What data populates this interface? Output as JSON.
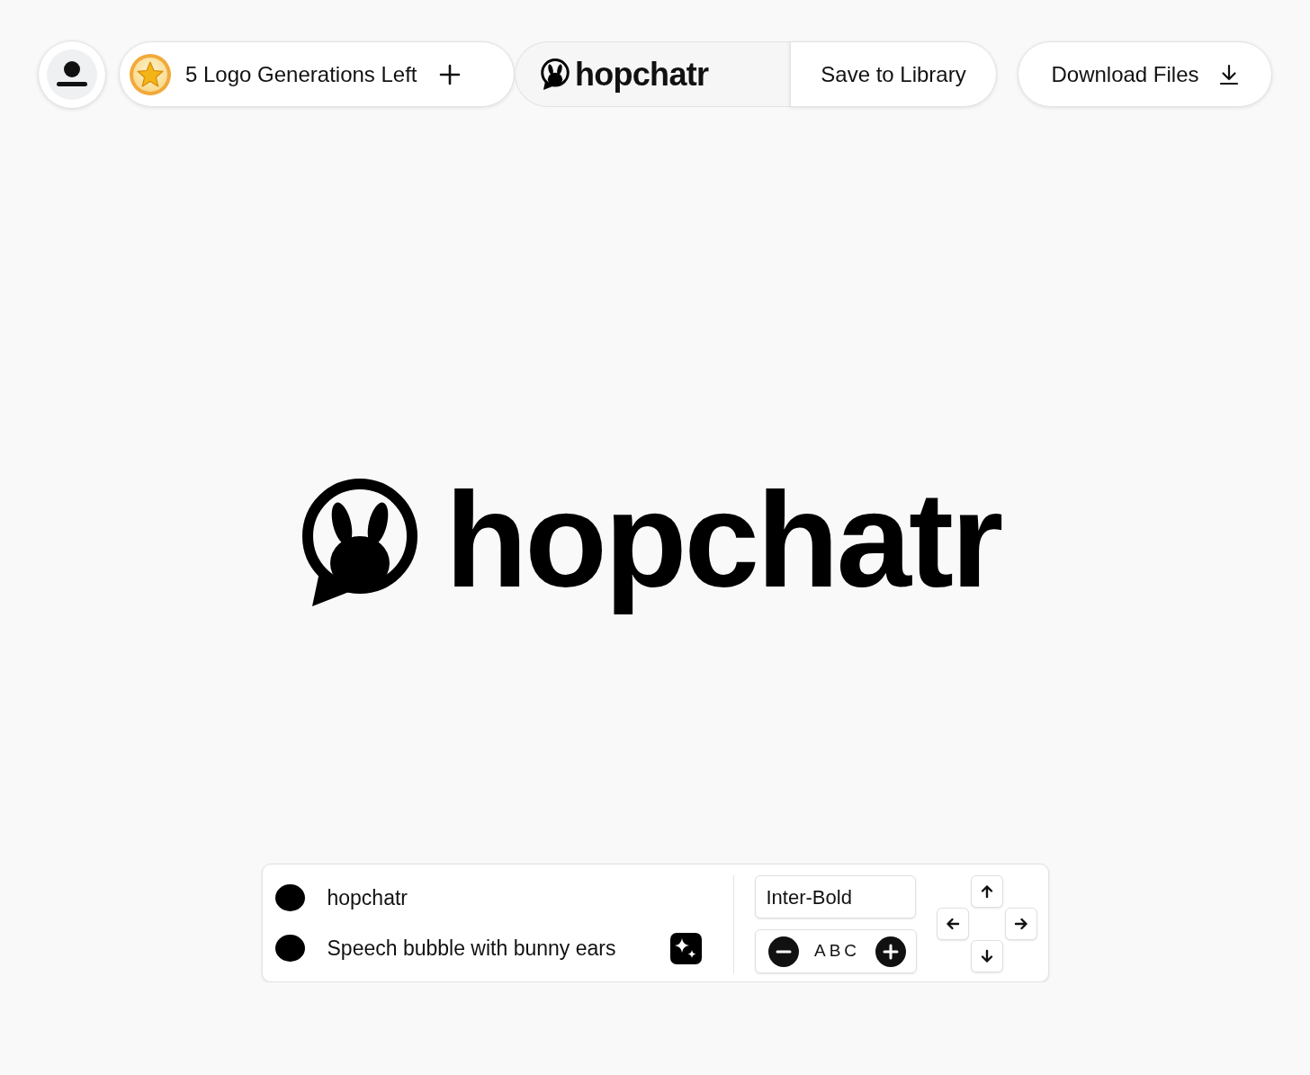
{
  "toolbar": {
    "credits_label": "5 Logo Generations Left",
    "logo_preview": "hopchatr",
    "save_button": "Save to Library",
    "download_button": "Download Files"
  },
  "canvas": {
    "wordmark": "hopchatr"
  },
  "editor": {
    "layers": [
      {
        "kind": "text",
        "color": "#000000",
        "value": "hopchatr"
      },
      {
        "kind": "icon",
        "color": "#000000",
        "value": "Speech bubble with bunny ears"
      }
    ],
    "font": "Inter-Bold",
    "spacing_preview": "ABC"
  }
}
